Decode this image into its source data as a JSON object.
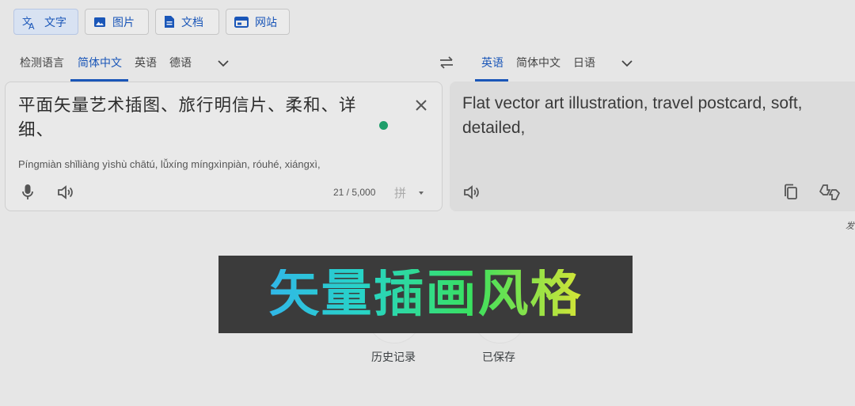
{
  "modes": [
    {
      "label": "文字",
      "icon": "translate-icon",
      "active": true
    },
    {
      "label": "图片",
      "icon": "image-icon",
      "active": false
    },
    {
      "label": "文档",
      "icon": "document-icon",
      "active": false
    },
    {
      "label": "网站",
      "icon": "website-icon",
      "active": false
    }
  ],
  "source_langs": {
    "detect": "检测语言",
    "selected": "简体中文",
    "opt2": "英语",
    "opt3": "德语"
  },
  "target_langs": {
    "selected": "英语",
    "opt1": "简体中文",
    "opt2": "日语"
  },
  "source": {
    "text": "平面矢量艺术插图、旅行明信片、柔和、详细、",
    "transliteration": "Píngmiàn shǐliàng yìshù chātú, lǚxíng míngxìnpiàn, róuhé, xiángxì,",
    "char_count": "21 / 5,000",
    "input_method": "拼"
  },
  "target": {
    "text": "Flat vector art illustration, travel postcard, soft, detailed,"
  },
  "edge_text": "发",
  "overlay_title": "矢量插画风格",
  "bottom": {
    "history": "历史记录",
    "saved": "已保存"
  },
  "colors": {
    "accent": "#1a56b8",
    "status_dot": "#1e9e6a"
  }
}
